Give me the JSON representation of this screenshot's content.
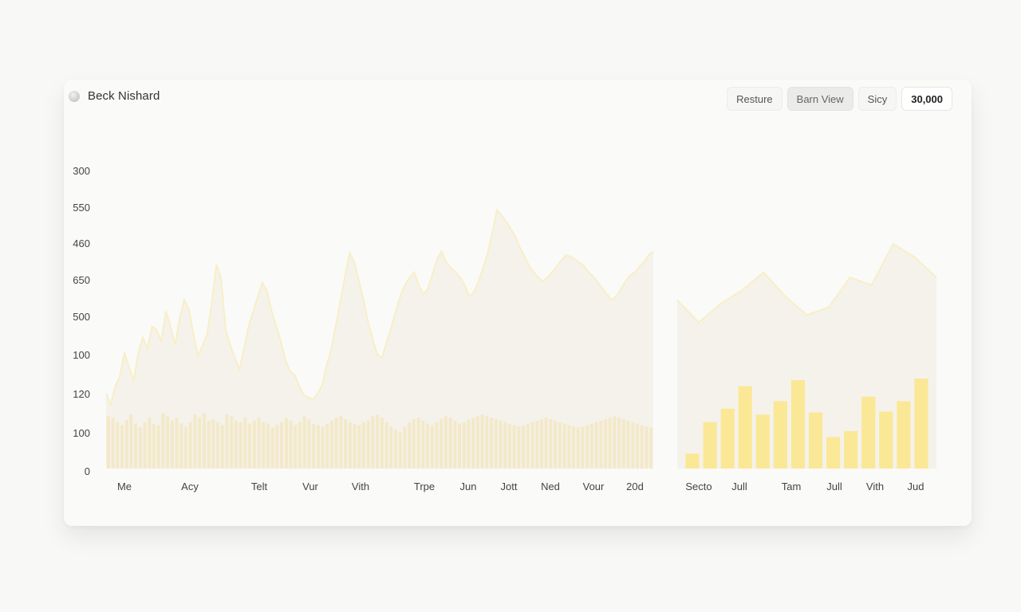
{
  "header": {
    "title": "Beck Nishard",
    "icon": "chart-logo-icon"
  },
  "toolbar": {
    "buttons": [
      "Resture",
      "Barn View",
      "Sicy"
    ],
    "active": "Barn View",
    "value": "30,000"
  },
  "colors": {
    "area_fill": "#f4f1ea",
    "area_line": "#f7efc6",
    "bar_light": "#f3e9c9",
    "bar_bright": "#fbe896"
  },
  "chart_data": [
    {
      "type": "area",
      "y_tick_labels": [
        "300",
        "550",
        "460",
        "650",
        "500",
        "100",
        "120",
        "100",
        "0"
      ],
      "x_tick_labels": [
        "Me",
        "Acy",
        "Telt",
        "Vur",
        "Vith",
        "Trpe",
        "Jun",
        "Jott",
        "Ned",
        "Vour",
        "20d"
      ],
      "area_series": {
        "values": [
          100,
          85,
          110,
          123,
          155,
          135,
          118,
          155,
          175,
          160,
          190,
          185,
          170,
          210,
          190,
          165,
          200,
          225,
          212,
          180,
          150,
          165,
          180,
          222,
          272,
          255,
          185,
          165,
          148,
          132,
          160,
          190,
          210,
          230,
          248,
          237,
          210,
          190,
          170,
          145,
          130,
          125,
          110,
          98,
          95,
          92,
          100,
          112,
          138,
          160,
          192,
          225,
          258,
          288,
          275,
          250,
          225,
          195,
          172,
          152,
          148,
          168,
          188,
          210,
          230,
          245,
          255,
          262,
          245,
          232,
          240,
          260,
          280,
          290,
          275,
          268,
          262,
          255,
          245,
          230,
          235,
          250,
          268,
          288,
          315,
          345,
          338,
          330,
          320,
          310,
          295,
          283,
          270,
          262,
          255,
          250,
          255,
          262,
          270,
          278,
          285,
          283,
          279,
          275,
          270,
          262,
          256,
          248,
          240,
          232,
          225,
          230,
          240,
          250,
          258,
          262,
          270,
          276,
          285,
          290
        ]
      },
      "bar_series": {
        "values": [
          70,
          68,
          62,
          58,
          65,
          72,
          60,
          55,
          62,
          68,
          60,
          58,
          74,
          70,
          64,
          68,
          60,
          56,
          62,
          72,
          68,
          74,
          64,
          66,
          62,
          58,
          72,
          70,
          64,
          62,
          68,
          60,
          64,
          68,
          62,
          60,
          55,
          58,
          62,
          68,
          64,
          58,
          62,
          70,
          66,
          60,
          58,
          56,
          60,
          64,
          68,
          70,
          66,
          62,
          60,
          58,
          62,
          64,
          70,
          72,
          68,
          62,
          56,
          52,
          48,
          56,
          62,
          66,
          68,
          64,
          60,
          58,
          62,
          66,
          70,
          68,
          64,
          60,
          62,
          66,
          68,
          70,
          72,
          70,
          68,
          66,
          64,
          62,
          60,
          58,
          56,
          58,
          60,
          62,
          64,
          66,
          68,
          66,
          64,
          62,
          60,
          58,
          56,
          55,
          56,
          58,
          60,
          62,
          64,
          66,
          68,
          70,
          68,
          66,
          64,
          62,
          60,
          58,
          56,
          55
        ]
      },
      "grid": false
    },
    {
      "type": "bar",
      "x_tick_labels": [
        "Secto",
        "Jull",
        "Tam",
        "Jull",
        "Vith",
        "Jud"
      ],
      "area_series": {
        "values": [
          225,
          195,
          220,
          238,
          262,
          230,
          205,
          215,
          255,
          245,
          300,
          282,
          255
        ]
      },
      "bar_series": {
        "values": [
          20,
          62,
          80,
          110,
          72,
          90,
          118,
          75,
          42,
          50,
          96,
          76,
          90,
          120
        ]
      }
    }
  ]
}
